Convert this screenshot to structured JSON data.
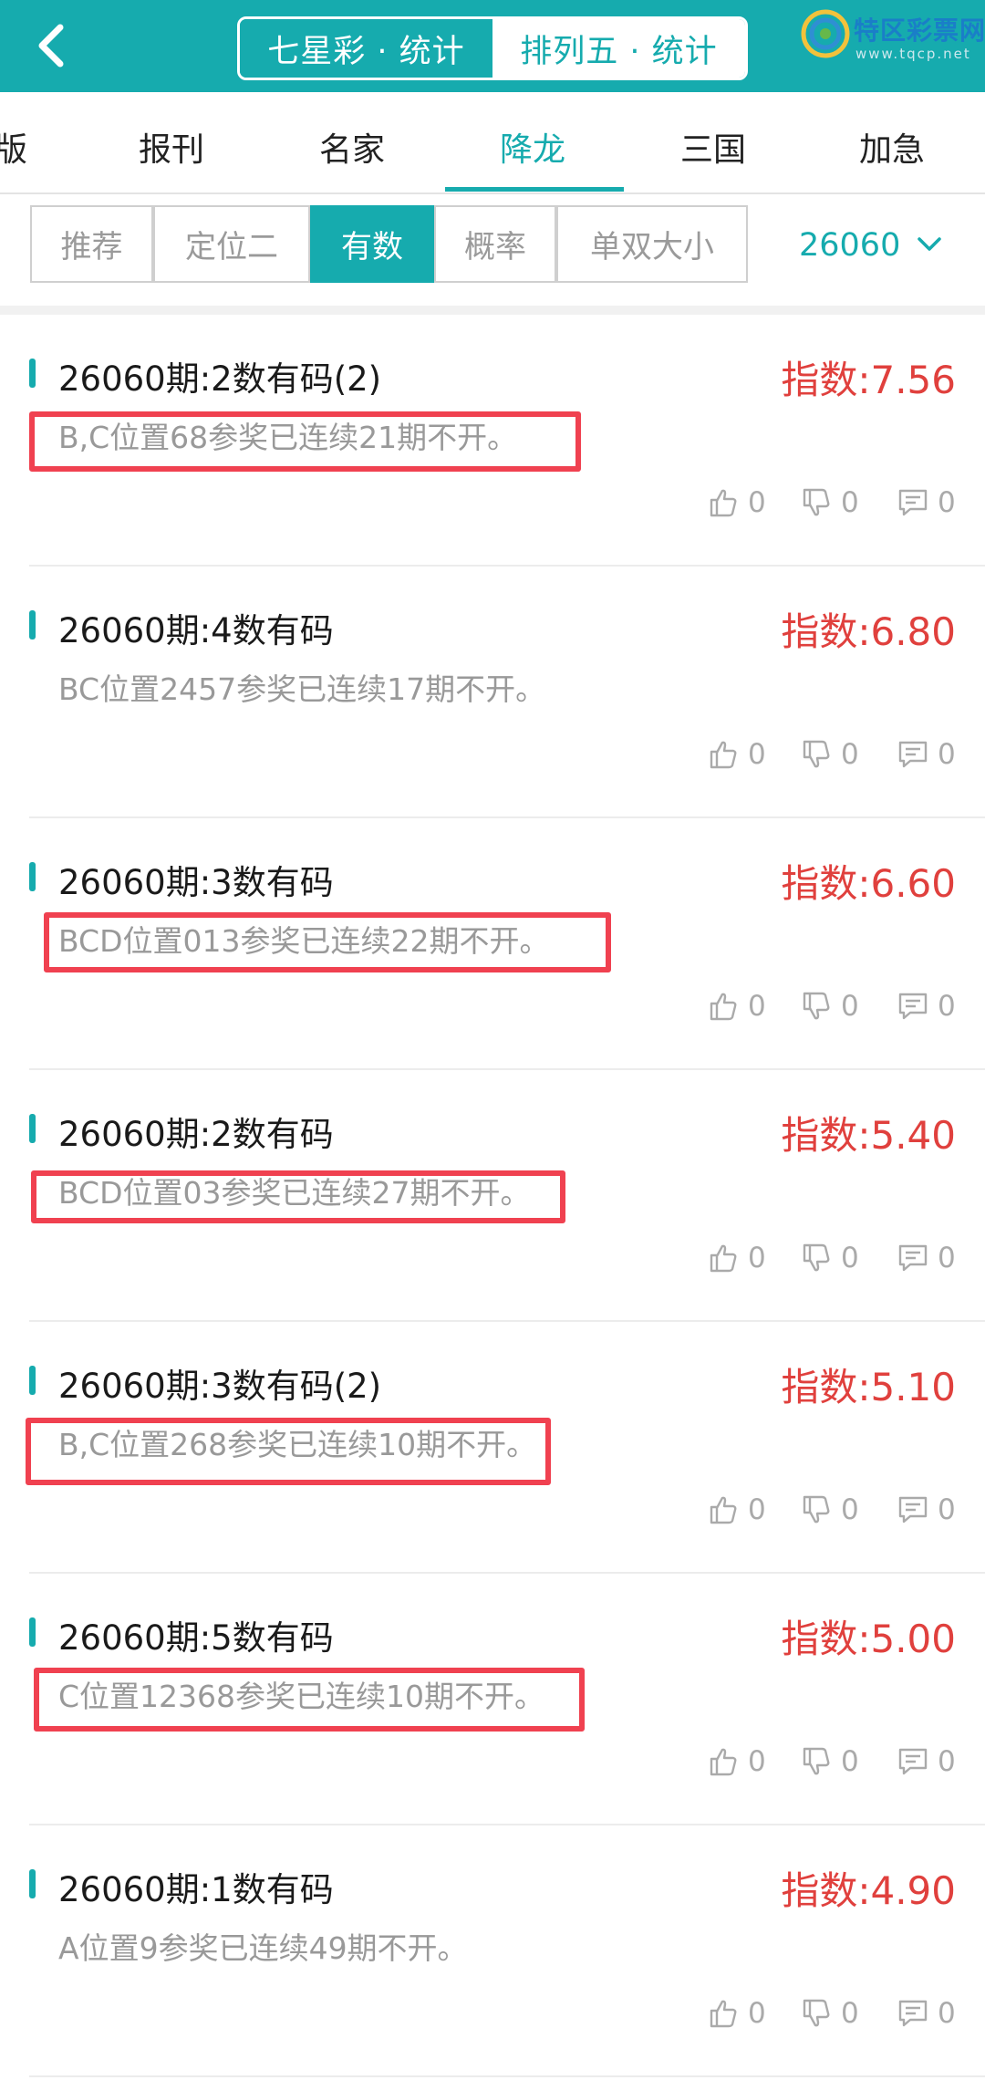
{
  "header": {
    "segments": [
      {
        "label": "七星彩 · 统计",
        "active": true
      },
      {
        "label": "排列五 · 统计",
        "active": false
      }
    ],
    "watermark": {
      "title": "特区彩票网",
      "url": "www.tqcp.net"
    }
  },
  "categories": [
    "版",
    "报刊",
    "名家",
    "降龙",
    "三国",
    "加急"
  ],
  "active_category": "降龙",
  "filters": [
    "推荐",
    "定位二",
    "有数",
    "概率",
    "单双大小"
  ],
  "active_filter": "有数",
  "issue": "26060",
  "items": [
    {
      "title": "26060期:2数有码(2)",
      "index": "指数:7.56",
      "desc": "B,C位置68参奖已连续21期不开。",
      "highlight": true,
      "likes": "0",
      "dislikes": "0",
      "comments": "0"
    },
    {
      "title": "26060期:4数有码",
      "index": "指数:6.80",
      "desc": "BC位置2457参奖已连续17期不开。",
      "highlight": false,
      "likes": "0",
      "dislikes": "0",
      "comments": "0"
    },
    {
      "title": "26060期:3数有码",
      "index": "指数:6.60",
      "desc": "BCD位置013参奖已连续22期不开。",
      "highlight": true,
      "likes": "0",
      "dislikes": "0",
      "comments": "0"
    },
    {
      "title": "26060期:2数有码",
      "index": "指数:5.40",
      "desc": "BCD位置03参奖已连续27期不开。",
      "highlight": true,
      "likes": "0",
      "dislikes": "0",
      "comments": "0"
    },
    {
      "title": "26060期:3数有码(2)",
      "index": "指数:5.10",
      "desc": "B,C位置268参奖已连续10期不开。",
      "highlight": true,
      "likes": "0",
      "dislikes": "0",
      "comments": "0"
    },
    {
      "title": "26060期:5数有码",
      "index": "指数:5.00",
      "desc": "C位置12368参奖已连续10期不开。",
      "highlight": true,
      "likes": "0",
      "dislikes": "0",
      "comments": "0"
    },
    {
      "title": "26060期:1数有码",
      "index": "指数:4.90",
      "desc": "A位置9参奖已连续49期不开。",
      "highlight": false,
      "likes": "0",
      "dislikes": "0",
      "comments": "0"
    }
  ],
  "colors": {
    "primary": "#16abae",
    "index_red": "#e0403d",
    "highlight_box": "#f04150"
  }
}
